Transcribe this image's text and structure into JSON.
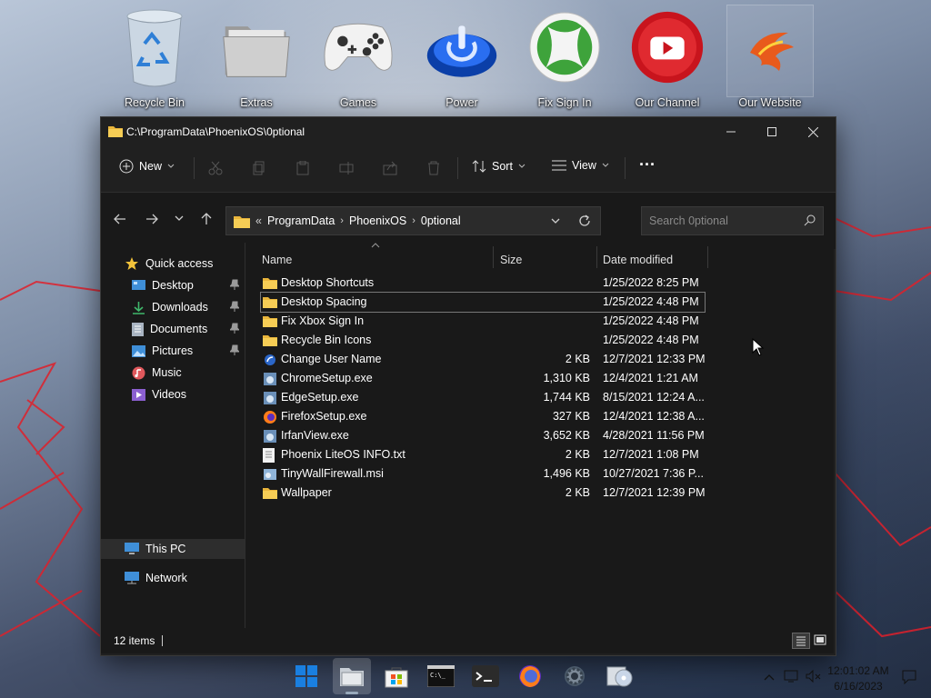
{
  "desktop": {
    "icons": [
      {
        "label": "Recycle Bin",
        "icon": "recycle-bin-icon"
      },
      {
        "label": "Extras",
        "icon": "folder-icon"
      },
      {
        "label": "Games",
        "icon": "gamepad-icon"
      },
      {
        "label": "Power",
        "icon": "power-icon"
      },
      {
        "label": "Fix Sign In",
        "icon": "xbox-icon"
      },
      {
        "label": "Our Channel",
        "icon": "youtube-icon"
      },
      {
        "label": "Our Website",
        "icon": "phoenix-icon"
      }
    ]
  },
  "window": {
    "title": "C:\\ProgramData\\PhoenixOS\\0ptional",
    "toolbar": {
      "new_label": "New",
      "sort_label": "Sort",
      "view_label": "View",
      "more_label": "···"
    },
    "address": {
      "overflow": "«",
      "crumbs": [
        "ProgramData",
        "PhoenixOS",
        "0ptional"
      ]
    },
    "search": {
      "placeholder": "Search 0ptional"
    },
    "nav": {
      "quick_access": "Quick access",
      "items": [
        {
          "label": "Desktop",
          "icon": "desktop-icon",
          "pinned": true
        },
        {
          "label": "Downloads",
          "icon": "download-icon",
          "pinned": true
        },
        {
          "label": "Documents",
          "icon": "document-icon",
          "pinned": true
        },
        {
          "label": "Pictures",
          "icon": "pictures-icon",
          "pinned": true
        },
        {
          "label": "Music",
          "icon": "music-icon",
          "pinned": false
        },
        {
          "label": "Videos",
          "icon": "video-icon",
          "pinned": false
        }
      ],
      "this_pc": "This PC",
      "network": "Network"
    },
    "columns": {
      "name": "Name",
      "size": "Size",
      "date": "Date modified"
    },
    "files": [
      {
        "name": "Desktop Shortcuts",
        "size": "",
        "date": "1/25/2022 8:25 PM",
        "type": "folder"
      },
      {
        "name": "Desktop Spacing",
        "size": "",
        "date": "1/25/2022 4:48 PM",
        "type": "folder",
        "selected": true
      },
      {
        "name": "Fix Xbox Sign In",
        "size": "",
        "date": "1/25/2022 4:48 PM",
        "type": "folder"
      },
      {
        "name": "Recycle Bin Icons",
        "size": "",
        "date": "1/25/2022 4:48 PM",
        "type": "folder"
      },
      {
        "name": "Change User Name",
        "size": "2 KB",
        "date": "12/7/2021 12:33 PM",
        "type": "shortcut"
      },
      {
        "name": "ChromeSetup.exe",
        "size": "1,310 KB",
        "date": "12/4/2021 1:21 AM",
        "type": "exe"
      },
      {
        "name": "EdgeSetup.exe",
        "size": "1,744 KB",
        "date": "8/15/2021 12:24 A...",
        "type": "exe"
      },
      {
        "name": "FirefoxSetup.exe",
        "size": "327 KB",
        "date": "12/4/2021 12:38 A...",
        "type": "firefox"
      },
      {
        "name": "IrfanView.exe",
        "size": "3,652 KB",
        "date": "4/28/2021 11:56 PM",
        "type": "exe"
      },
      {
        "name": "Phoenix LiteOS INFO.txt",
        "size": "2 KB",
        "date": "12/7/2021 1:08 PM",
        "type": "txt"
      },
      {
        "name": "TinyWallFirewall.msi",
        "size": "1,496 KB",
        "date": "10/27/2021 7:36 P...",
        "type": "msi"
      },
      {
        "name": "Wallpaper",
        "size": "2 KB",
        "date": "12/7/2021 12:39 PM",
        "type": "folder"
      }
    ],
    "status": {
      "count": "12 items"
    }
  },
  "taskbar": {
    "apps": [
      {
        "name": "start",
        "icon": "windows-start-icon"
      },
      {
        "name": "file-explorer",
        "icon": "file-explorer-icon",
        "active": true
      },
      {
        "name": "store",
        "icon": "store-icon"
      },
      {
        "name": "command-prompt",
        "icon": "cmd-icon"
      },
      {
        "name": "terminal",
        "icon": "terminal-icon"
      },
      {
        "name": "firefox",
        "icon": "firefox-icon"
      },
      {
        "name": "settings",
        "icon": "settings-gear-icon"
      },
      {
        "name": "media-player",
        "icon": "media-player-icon"
      }
    ],
    "clock": {
      "time": "12:01:02 AM",
      "date": "6/16/2023"
    }
  },
  "colors": {
    "window_bg": "#202020",
    "content_bg": "#191919",
    "folder_yellow": "#f4c542",
    "accent": "#4aa3df"
  }
}
